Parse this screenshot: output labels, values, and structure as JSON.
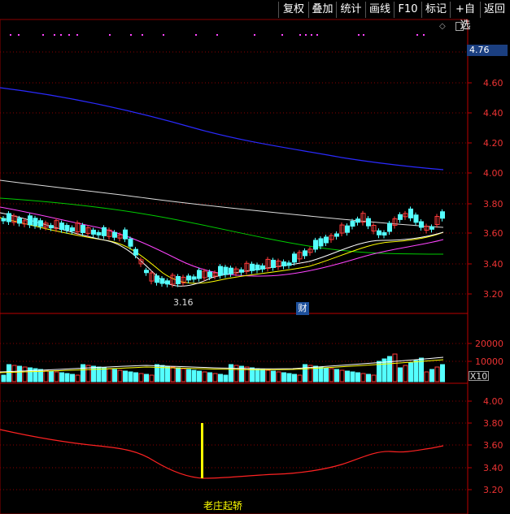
{
  "toolbar": {
    "items": [
      "复权",
      "叠加",
      "统计",
      "画线",
      "F10",
      "标记",
      "+自选",
      "返回"
    ]
  },
  "price_axis": {
    "current_price": "4.76",
    "ticks": [
      "4.60",
      "4.40",
      "4.20",
      "4.00",
      "3.80",
      "3.60",
      "3.40",
      "3.20"
    ]
  },
  "low_annotation": "3.16",
  "finance_badge": "财",
  "volume_axis": {
    "ticks": [
      "20000",
      "10000"
    ],
    "multiplier": "X10"
  },
  "indicator_axis": {
    "ticks": [
      "4.00",
      "3.80",
      "3.60",
      "3.40",
      "3.20"
    ]
  },
  "event_label": "老庄起轿",
  "colors": {
    "up": "#ff3b3b",
    "down": "#54ffff",
    "grid": "#8b0000",
    "ma_white": "#ffffff",
    "ma_yellow": "#ffff00",
    "ma_magenta": "#ff44ff",
    "ma_green": "#00cc00",
    "ma_blue": "#2a2aff",
    "indicator_line": "#ff2222",
    "event_bar": "#ffff00"
  },
  "icons": [
    "diamond-icon",
    "scroll-icon"
  ]
}
